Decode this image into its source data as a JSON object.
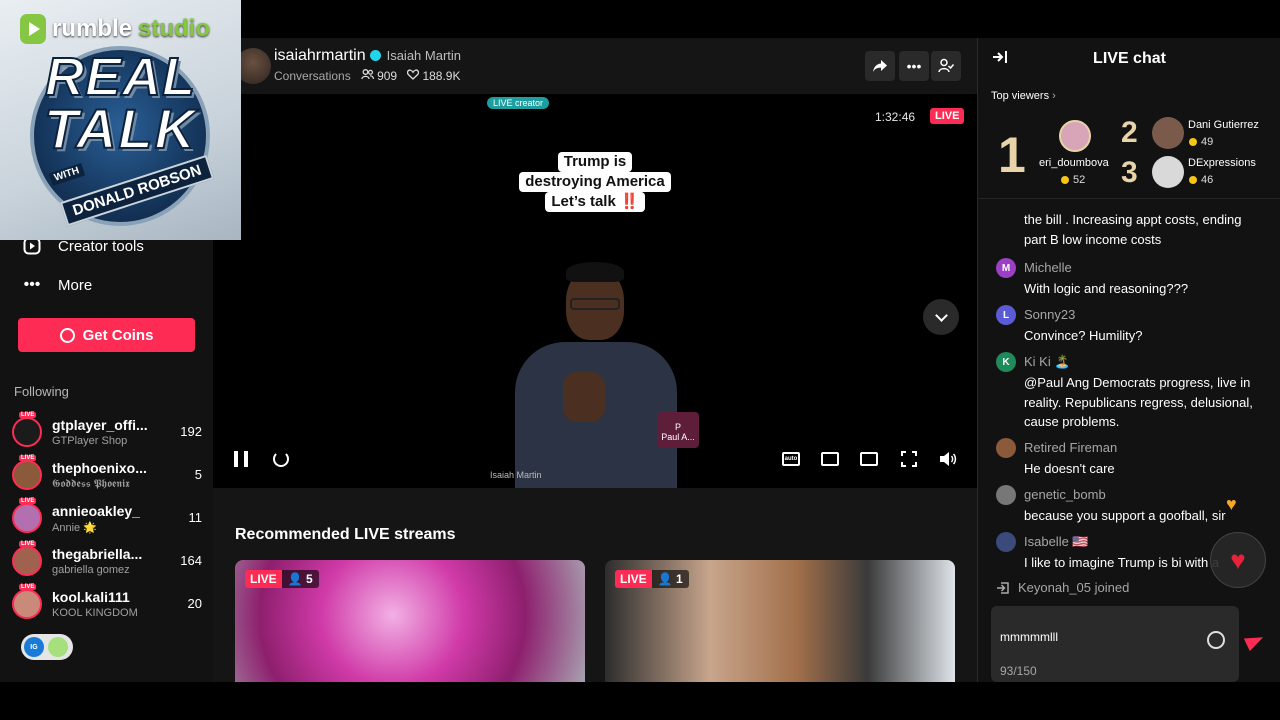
{
  "logo": {
    "rumble": "rumble",
    "studio": "studio",
    "line1": "REAL",
    "line2": "TALK",
    "with": "WITH",
    "name": "DONALD ROBSON"
  },
  "sidebar": {
    "nav": [
      {
        "label": "Creator tools",
        "icon": "creator-tools-icon"
      },
      {
        "label": "More",
        "icon": "more-dots-icon"
      }
    ],
    "get_coins": "Get Coins",
    "following_label": "Following",
    "following": [
      {
        "name": "gtplayer_offi...",
        "sub": "GTPlayer Shop",
        "count": "192",
        "live": "LIVE"
      },
      {
        "name": "thephoenixo...",
        "sub": "𝕲𝖔𝖉𝖉𝖊𝖘𝖘 𝕻𝖍𝖔𝖊𝖓𝖎𝖝",
        "count": "5",
        "live": "LIVE"
      },
      {
        "name": "annieoakley_",
        "sub": "Annie 🌟",
        "count": "11",
        "live": "LIVE"
      },
      {
        "name": "thegabriella...",
        "sub": "gabriella gomez",
        "count": "164",
        "live": "LIVE"
      },
      {
        "name": "kool.kali111",
        "sub": "KOOL KINGDOM",
        "count": "20",
        "live": "LIVE"
      }
    ],
    "toggle_label": "IG"
  },
  "stream": {
    "username": "isaiahrmartin",
    "display_name": "Isaiah Martin",
    "category": "Conversations",
    "viewers": "909",
    "likes": "188.9K",
    "creator_badge": "LIVE creator",
    "timer": "1:32:46",
    "live": "LIVE",
    "overlay_lines": [
      "Trump is",
      "destroying America",
      "Let’s talk ‼️"
    ],
    "camera_label": "Isaiah Martin",
    "guest_label": "Paul A...",
    "guest_initial": "P"
  },
  "recommended": {
    "title": "Recommended LIVE streams",
    "cards": [
      {
        "live": "LIVE",
        "viewers": "5"
      },
      {
        "live": "LIVE",
        "viewers": "1"
      }
    ]
  },
  "chat": {
    "title": "LIVE chat",
    "top_viewers_label": "Top viewers",
    "top_viewers": [
      {
        "rank": "1",
        "name": "eri_doumbova",
        "coins": "52"
      },
      {
        "rank": "2",
        "name": "Dani Gutierrez",
        "coins": "49"
      },
      {
        "rank": "3",
        "name": "DExpressions",
        "coins": "46"
      }
    ],
    "partial_message": "the bill . Increasing appt costs, ending part B low income costs",
    "messages": [
      {
        "user": "Michelle",
        "initial": "M",
        "color": "#9b3fc4",
        "text": "With logic and reasoning???"
      },
      {
        "user": "Sonny23",
        "initial": "L",
        "color": "#5b5bd6",
        "text": "Convince? Humility?"
      },
      {
        "user": "Ki Ki 🏝️",
        "initial": "K",
        "color": "#1f8a5a",
        "text": "@Paul Ang Democrats progress, live in reality. Republicans regress, delusional, cause problems."
      },
      {
        "user": "Retired Fireman",
        "initial": "",
        "color": "#8a5a3a",
        "text": "He doesn't care"
      },
      {
        "user": "genetic_bomb",
        "initial": "",
        "color": "#777777",
        "text": "because you support a goofball, sir"
      },
      {
        "user": "Isabelle 🇺🇸",
        "initial": "",
        "color": "#3a4a7a",
        "text": "I like to imagine Trump is bi with a"
      }
    ],
    "joined": "Keyonah_05 joined",
    "input_value": "mmmmmlll",
    "char_count": "93/150"
  }
}
